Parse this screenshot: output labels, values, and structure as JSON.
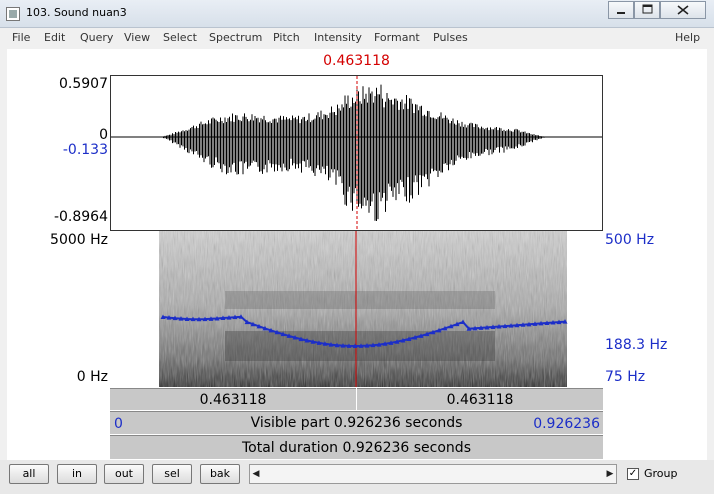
{
  "window": {
    "title": "103. Sound nuan3"
  },
  "menu": [
    "File",
    "Edit",
    "Query",
    "View",
    "Select",
    "Spectrum",
    "Pitch",
    "Intensity",
    "Formant",
    "Pulses",
    "Help"
  ],
  "cursor": {
    "time_label": "0.463118",
    "time_fraction": 0.5
  },
  "waveform": {
    "max_label": "0.5907",
    "zero_label": "0",
    "cursor_value_label": "-0.133",
    "min_label": "-0.8964"
  },
  "spectrogram": {
    "top_label": "5000 Hz",
    "bottom_label": "0 Hz"
  },
  "pitch_axis": {
    "top_label": "500 Hz",
    "value_label": "188.3 Hz",
    "bottom_label": "75 Hz"
  },
  "time_bars": {
    "left_segment": "0.463118",
    "right_segment": "0.463118",
    "visible_start": "0",
    "visible_text": "Visible part 0.926236 seconds",
    "visible_end": "0.926236",
    "total_text": "Total duration 0.926236 seconds"
  },
  "buttons": {
    "all": "all",
    "in": "in",
    "out": "out",
    "sel": "sel",
    "bak": "bak"
  },
  "group": {
    "label": "Group",
    "checked": true,
    "check_mark": "✓"
  },
  "colors": {
    "cursor": "#d40000",
    "pitch": "#1c2ec8",
    "axis_blue": "#1c2ec8"
  }
}
